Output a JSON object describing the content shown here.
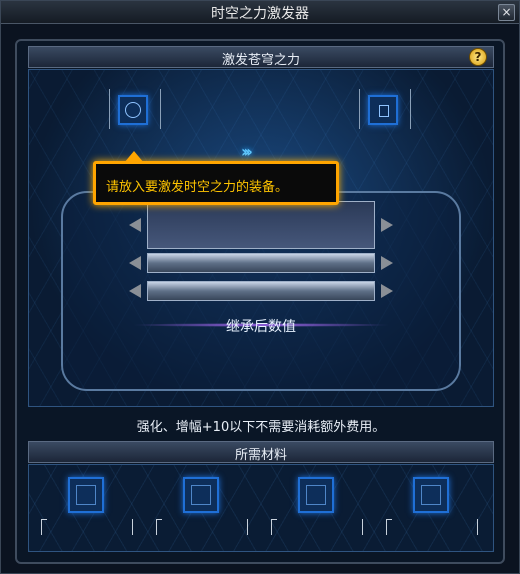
{
  "window": {
    "title": "时空之力激发器",
    "close_label": "×"
  },
  "panel": {
    "title": "激发苍穹之力",
    "help_label": "?"
  },
  "tooltip": {
    "text": "请放入要激发时空之力的装备。"
  },
  "main": {
    "inherit_label": "继承后数值",
    "info_text": "强化、增幅+10以下不需要消耗额外费用。"
  },
  "materials": {
    "title": "所需材料"
  },
  "colors": {
    "accent": "#1f6fd6",
    "tooltip_border": "#ffa500",
    "tooltip_text": "#ffc400"
  }
}
